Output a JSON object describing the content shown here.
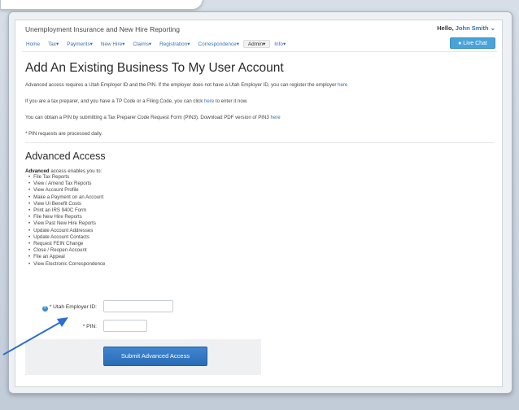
{
  "app": {
    "title": "Unemployment Insurance and New Hire Reporting",
    "greeting": "Hello,",
    "user_name": "John Smith",
    "live_chat_label": "Live Chat"
  },
  "nav": {
    "items": [
      {
        "label": "Home"
      },
      {
        "label": "Tax"
      },
      {
        "label": "Payments"
      },
      {
        "label": "New Hire"
      },
      {
        "label": "Claims"
      },
      {
        "label": "Registration"
      },
      {
        "label": "Correspondence"
      },
      {
        "label": "Admin"
      },
      {
        "label": "Info"
      }
    ],
    "active": "Admin"
  },
  "main": {
    "title": "Add An Existing Business To My User Account",
    "para1_text": "Advanced access requires a Utah Employer ID and the PIN. If the employer does not have a Utah Employer ID, you can register the employer",
    "para1_link": "here",
    "para2_text": "If you are a tax preparer, and you have a TP Code or a Filing Code, you can click",
    "para2_link": "here",
    "para2_tail": "to enter it now.",
    "para3_text": "You can obtain a PIN by submitting a Tax Preparer Code Request Form (PIN3). Download PDF version of PIN3",
    "para3_link": "here",
    "para4_text": "* PIN requests are processed daily."
  },
  "advanced": {
    "heading": "Advanced Access",
    "intro_bold": "Advanced",
    "intro_rest": "access enables you to:",
    "features": [
      "File Tax Reports",
      "View / Amend Tax Reports",
      "View Account Profile",
      "Make a Payment on an Account",
      "View UI Benefit Costs",
      "Print an IRS 940C Form",
      "File New Hire Reports",
      "View Past New Hire Reports",
      "Update Account Addresses",
      "Update Account Contacts",
      "Request FEIN Change",
      "Close / Reopen Account",
      "File an Appeal",
      "View Electronic Correspondence"
    ],
    "employer_id_label": "* Utah Employer ID:",
    "employer_id_value": "",
    "pin_label": "* PIN:",
    "pin_value": "",
    "submit_label": "Submit Advanced Access"
  },
  "colors": {
    "accent": "#3a6fb0",
    "button": "#2f78c4",
    "arrow": "#2b6fd3"
  },
  "icons": {
    "help": "help-circle-icon",
    "chat": "chat-bubble-icon",
    "user_menu": "chevron-down-icon"
  }
}
